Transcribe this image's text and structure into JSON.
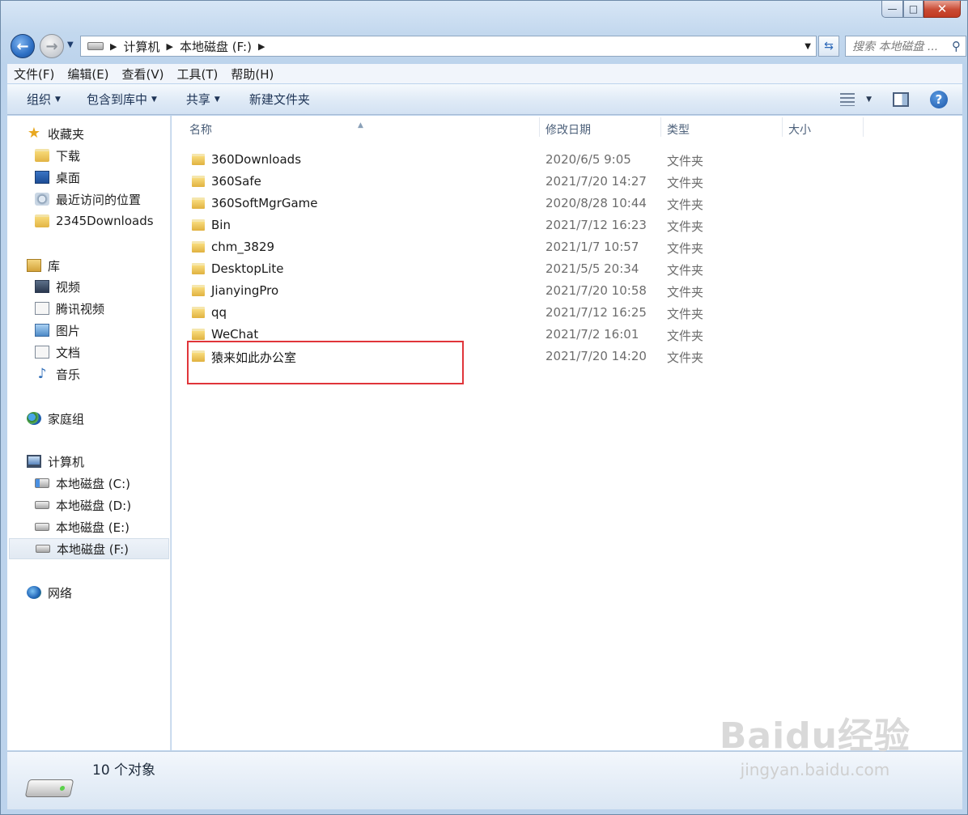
{
  "window": {
    "caption": {
      "minimize": "—",
      "maximize": "□",
      "close": "✕"
    }
  },
  "nav": {
    "breadcrumb": [
      "计算机",
      "本地磁盘 (F:)"
    ],
    "search_placeholder": "搜索 本地磁盘 ..."
  },
  "menu": [
    "文件(F)",
    "编辑(E)",
    "查看(V)",
    "工具(T)",
    "帮助(H)"
  ],
  "toolbar": {
    "organize": "组织",
    "include_library": "包含到库中",
    "share": "共享",
    "new_folder": "新建文件夹"
  },
  "sidebar": {
    "favorites": {
      "label": "收藏夹",
      "items": [
        "下载",
        "桌面",
        "最近访问的位置",
        "2345Downloads"
      ]
    },
    "libraries": {
      "label": "库",
      "items": [
        "视频",
        "腾讯视频",
        "图片",
        "文档",
        "音乐"
      ]
    },
    "homegroup": {
      "label": "家庭组"
    },
    "computer": {
      "label": "计算机",
      "items": [
        "本地磁盘 (C:)",
        "本地磁盘 (D:)",
        "本地磁盘 (E:)",
        "本地磁盘 (F:)"
      ]
    },
    "network": {
      "label": "网络"
    }
  },
  "columns": {
    "name": "名称",
    "modified": "修改日期",
    "type": "类型",
    "size": "大小"
  },
  "files": [
    {
      "name": "360Downloads",
      "date": "2020/6/5 9:05",
      "type": "文件夹"
    },
    {
      "name": "360Safe",
      "date": "2021/7/20 14:27",
      "type": "文件夹"
    },
    {
      "name": "360SoftMgrGame",
      "date": "2020/8/28 10:44",
      "type": "文件夹"
    },
    {
      "name": "Bin",
      "date": "2021/7/12 16:23",
      "type": "文件夹"
    },
    {
      "name": "chm_3829",
      "date": "2021/1/7 10:57",
      "type": "文件夹"
    },
    {
      "name": "DesktopLite",
      "date": "2021/5/5 20:34",
      "type": "文件夹"
    },
    {
      "name": "JianyingPro",
      "date": "2021/7/20 10:58",
      "type": "文件夹"
    },
    {
      "name": "qq",
      "date": "2021/7/12 16:25",
      "type": "文件夹"
    },
    {
      "name": "WeChat",
      "date": "2021/7/2 16:01",
      "type": "文件夹"
    },
    {
      "name": "猿来如此办公室",
      "date": "2021/7/20 14:20",
      "type": "文件夹"
    }
  ],
  "status": {
    "count": "10 个对象"
  },
  "watermark": {
    "title": "Baidu经验",
    "url": "jingyan.baidu.com"
  },
  "colors": {
    "highlight": "#e0353a"
  }
}
